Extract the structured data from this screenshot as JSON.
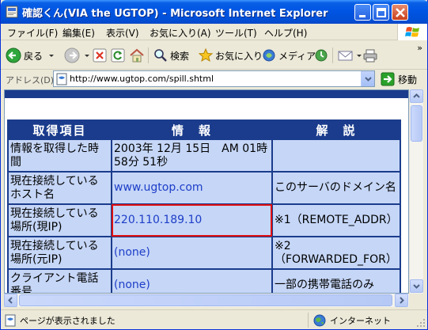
{
  "window": {
    "title": "確認くん(VIA the UGTOP) - Microsoft Internet Explorer"
  },
  "menu": [
    "ファイル(F)",
    "編集(E)",
    "表示(V)",
    "お気に入り(A)",
    "ツール(T)",
    "ヘルプ(H)"
  ],
  "toolbar": {
    "back": "戻る",
    "search": "検索",
    "favorites": "お気に入り",
    "media": "メディア"
  },
  "address": {
    "label": "アドレス(D)",
    "url": "http://www.ugtop.com/spill.shtml",
    "go": "移動"
  },
  "page": {
    "headers": [
      "取得項目",
      "情　報",
      "解　説"
    ],
    "rows": [
      {
        "item": "情報を取得した時間",
        "info": "2003年 12月 15日　AM 01時 58分 51秒",
        "note": ""
      },
      {
        "item": "現在接続しているホスト名",
        "info": "www.ugtop.com",
        "note": "このサーバのドメイン名"
      },
      {
        "item": "現在接続している場所(現IP)",
        "info": "220.110.189.10",
        "note": "※1（REMOTE_ADDR）"
      },
      {
        "item": "現在接続している場所(元IP)",
        "info": "(none)",
        "note": "※2（FORWARDED_FOR）"
      },
      {
        "item": "クライアント電話番号",
        "info": "(none)",
        "note": "一部の携帯電話のみ"
      }
    ]
  },
  "status": {
    "text": "ページが表示されました",
    "zone": "インターネット"
  }
}
